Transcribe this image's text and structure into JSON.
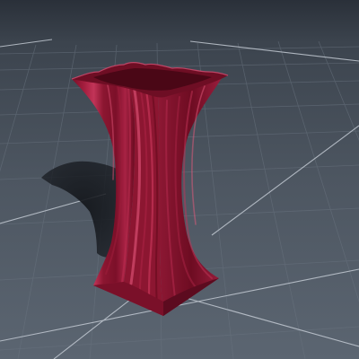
{
  "scene": {
    "background_top": "#2a3039",
    "background_horizon": "#47505b",
    "background_bottom": "#5a6470",
    "floor_fine_grid_color": "#6a7480",
    "floor_major_grid_color": "#c2c9d2",
    "object": {
      "kind": "fluted-vase",
      "color_base": "#8a1530",
      "color_light": "#c23458",
      "color_shadow": "#5c0b1f",
      "color_rim_inner": "#6e0e24"
    },
    "shadow_color": "#15181d"
  }
}
